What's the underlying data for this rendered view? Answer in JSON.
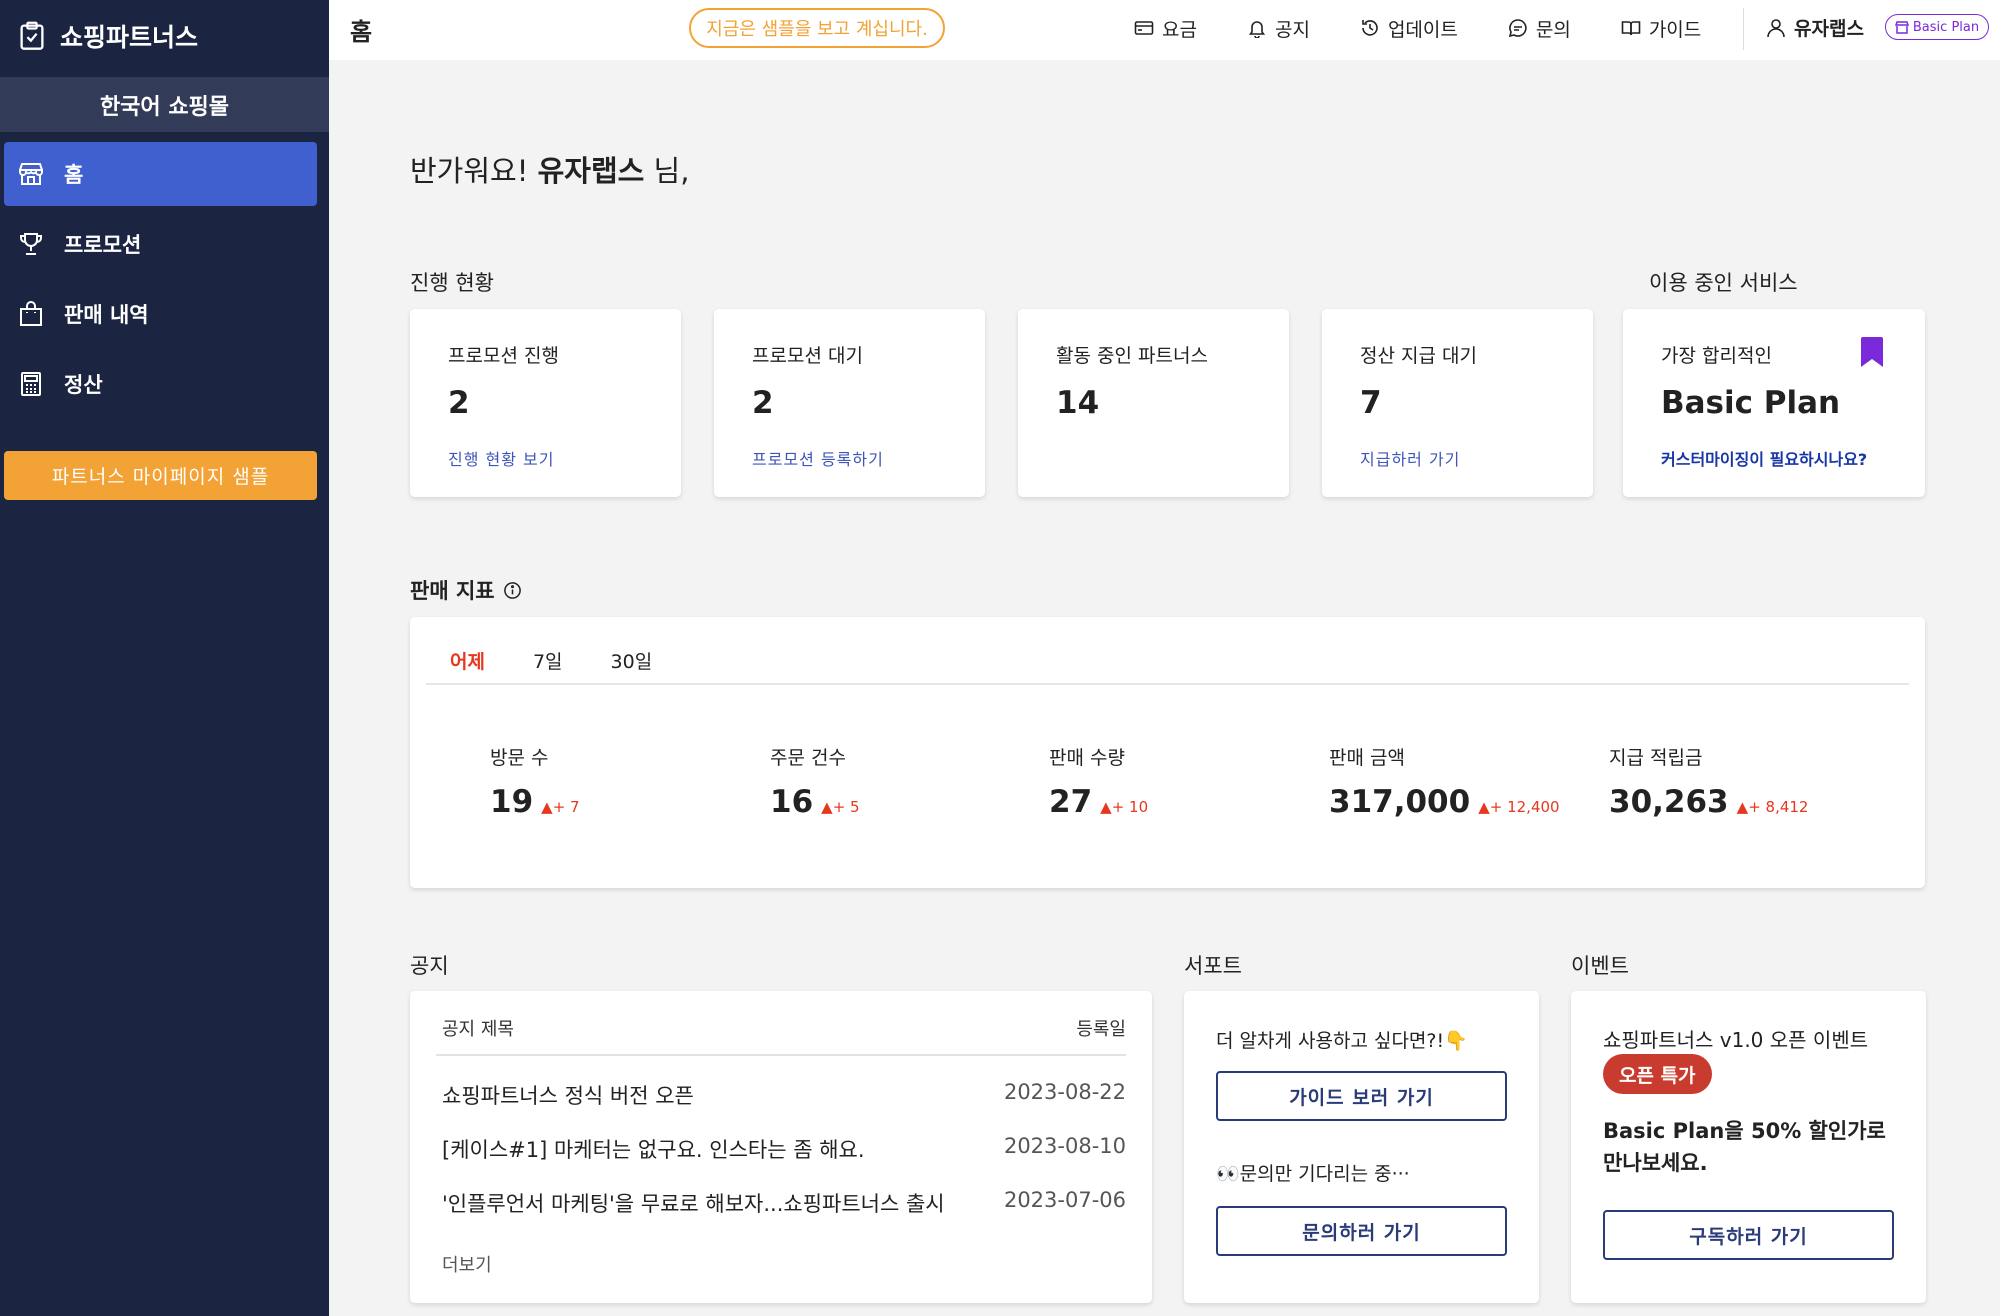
{
  "sidebar": {
    "brand": "쇼핑파트너스",
    "mall": "한국어 쇼핑몰",
    "items": [
      {
        "label": "홈",
        "icon": "store-icon"
      },
      {
        "label": "프로모션",
        "icon": "trophy-icon"
      },
      {
        "label": "판매 내역",
        "icon": "bag-icon"
      },
      {
        "label": "정산",
        "icon": "calculator-icon"
      }
    ],
    "sample_button": "파트너스 마이페이지 샘플"
  },
  "topbar": {
    "title": "홈",
    "notice": "지금은 샘플을 보고 계십니다.",
    "links": [
      {
        "label": "요금",
        "icon": "card-icon"
      },
      {
        "label": "공지",
        "icon": "bell-icon"
      },
      {
        "label": "업데이트",
        "icon": "history-icon"
      },
      {
        "label": "문의",
        "icon": "chat-icon"
      },
      {
        "label": "가이드",
        "icon": "book-icon"
      }
    ],
    "user": "유자랩스",
    "plan_badge": "Basic Plan"
  },
  "greeting": {
    "prefix": "반가워요! ",
    "name": "유자랩스",
    "suffix": " 님,"
  },
  "progress": {
    "title": "진행 현황",
    "cards": [
      {
        "label": "프로모션 진행",
        "value": "2",
        "link": "진행 현황 보기"
      },
      {
        "label": "프로모션 대기",
        "value": "2",
        "link": "프로모션 등록하기"
      },
      {
        "label": "활동 중인 파트너스",
        "value": "14",
        "link": ""
      },
      {
        "label": "정산 지급 대기",
        "value": "7",
        "link": "지급하러 가기"
      }
    ]
  },
  "service": {
    "title": "이용 중인 서비스",
    "tag": "가장 합리적인",
    "plan": "Basic Plan",
    "link": "커스터마이징이 필요하시나요?",
    "accent": "#7a2ad9"
  },
  "metrics": {
    "title": "판매 지표",
    "tabs": [
      "어제",
      "7일",
      "30일"
    ],
    "items": [
      {
        "label": "방문 수",
        "value": "19",
        "delta": "+ 7"
      },
      {
        "label": "주문 건수",
        "value": "16",
        "delta": "+ 5"
      },
      {
        "label": "판매 수량",
        "value": "27",
        "delta": "+ 10"
      },
      {
        "label": "판매 금액",
        "value": "317,000",
        "delta": "+ 12,400"
      },
      {
        "label": "지급 적립금",
        "value": "30,263",
        "delta": "+ 8,412"
      }
    ]
  },
  "notice": {
    "title": "공지",
    "col_title": "공지 제목",
    "col_date": "등록일",
    "rows": [
      {
        "title": "쇼핑파트너스 정식 버전 오픈",
        "date": "2023-08-22"
      },
      {
        "title": "[케이스#1] 마케터는 없구요. 인스타는 좀 해요.",
        "date": "2023-08-10"
      },
      {
        "title": "'인플루언서 마케팅'을 무료로 해보자...쇼핑파트너스 출시",
        "date": "2023-07-06"
      }
    ],
    "more": "더보기"
  },
  "support": {
    "title": "서포트",
    "text1": "더 알차게 사용하고 싶다면?!👇",
    "button1": "가이드 보러 가기",
    "text2": "👀문의만 기다리는 중···",
    "button2": "문의하러 가기"
  },
  "event": {
    "title": "이벤트",
    "event_name": "쇼핑파트너스 v1.0 오픈 이벤트",
    "badge": "오픈 특가",
    "desc": "Basic Plan을 50% 할인가로 만나보세요.",
    "button": "구독하러 가기"
  }
}
